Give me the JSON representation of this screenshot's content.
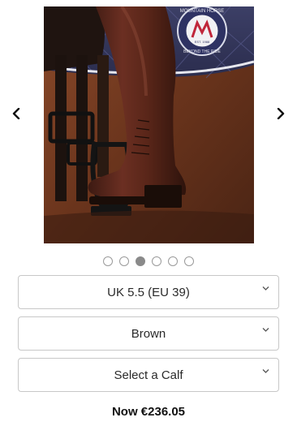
{
  "gallery": {
    "dot_count": 6,
    "active_index": 2,
    "badge": {
      "brand_text": "MOUNTAIN HORSE",
      "est_text": "EST. 1988",
      "tagline": "BEYOND THE RIDE"
    }
  },
  "options": {
    "size": {
      "value": "UK 5.5 (EU 39)"
    },
    "color": {
      "value": "Brown"
    },
    "calf": {
      "value": "Select a Calf"
    }
  },
  "price": {
    "label": "Now €236.05"
  }
}
